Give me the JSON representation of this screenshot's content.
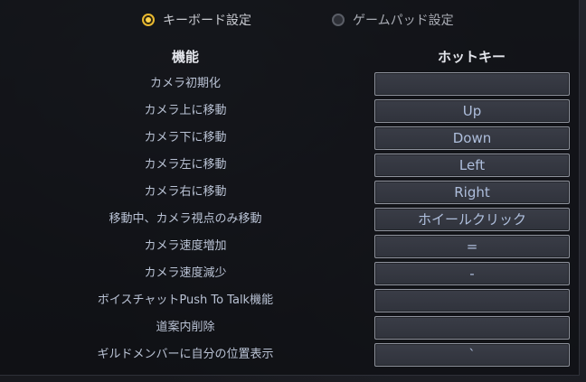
{
  "mode": {
    "keyboard_label": "キーボード設定",
    "gamepad_label": "ゲームパッド設定",
    "selected": "keyboard"
  },
  "headers": {
    "function": "機能",
    "hotkey": "ホットキー"
  },
  "rows": [
    {
      "function": "カメラ初期化",
      "hotkey": ""
    },
    {
      "function": "カメラ上に移動",
      "hotkey": "Up"
    },
    {
      "function": "カメラ下に移動",
      "hotkey": "Down"
    },
    {
      "function": "カメラ左に移動",
      "hotkey": "Left"
    },
    {
      "function": "カメラ右に移動",
      "hotkey": "Right"
    },
    {
      "function": "移動中、カメラ視点のみ移動",
      "hotkey": "ホイールクリック"
    },
    {
      "function": "カメラ速度増加",
      "hotkey": "="
    },
    {
      "function": "カメラ速度減少",
      "hotkey": "-"
    },
    {
      "function": "ボイスチャットPush To Talk機能",
      "hotkey": ""
    },
    {
      "function": "道案内削除",
      "hotkey": ""
    },
    {
      "function": "ギルドメンバーに自分の位置表示",
      "hotkey": "`"
    }
  ],
  "colors": {
    "radio_selected": "#ffd24a",
    "key_text": "#aebedc",
    "label_text": "#b9c2d4"
  }
}
